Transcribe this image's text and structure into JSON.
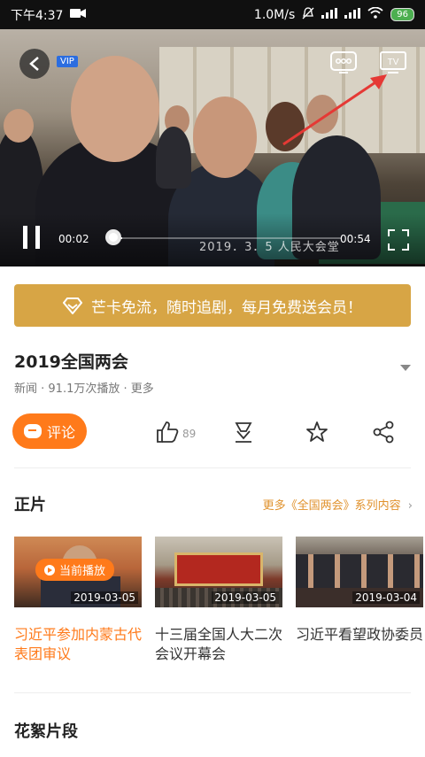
{
  "status": {
    "time": "下午4:37",
    "speed": "1.0M/s",
    "battery": "96"
  },
  "video": {
    "badge": "VIP",
    "current_time": "00:02",
    "duration": "00:54",
    "caption": "2019．3．5  人民大会堂",
    "progress": 0.04,
    "tv_label": "TV"
  },
  "banner": {
    "text": "芒卡免流，随时追剧，每月免费送会员！"
  },
  "info": {
    "title": "2019全国两会",
    "meta": "新闻 · 91.1万次播放 · 更多"
  },
  "actions": {
    "comment_label": "评论",
    "like_count": "89"
  },
  "episodes": {
    "section_title": "正片",
    "more_label": "更多《全国两会》系列内容",
    "now_playing_label": "当前播放",
    "items": [
      {
        "date": "2019-03-05",
        "title": "习近平参加内蒙古代表团审议"
      },
      {
        "date": "2019-03-05",
        "title": "十三届全国人大二次会议开幕会"
      },
      {
        "date": "2019-03-04",
        "title": "习近平看望政协委员"
      }
    ]
  },
  "clips": {
    "section_title": "花絮片段"
  },
  "colors": {
    "accent": "#ff7a1a",
    "banner": "#d7a545",
    "arrow": "#e53935"
  }
}
